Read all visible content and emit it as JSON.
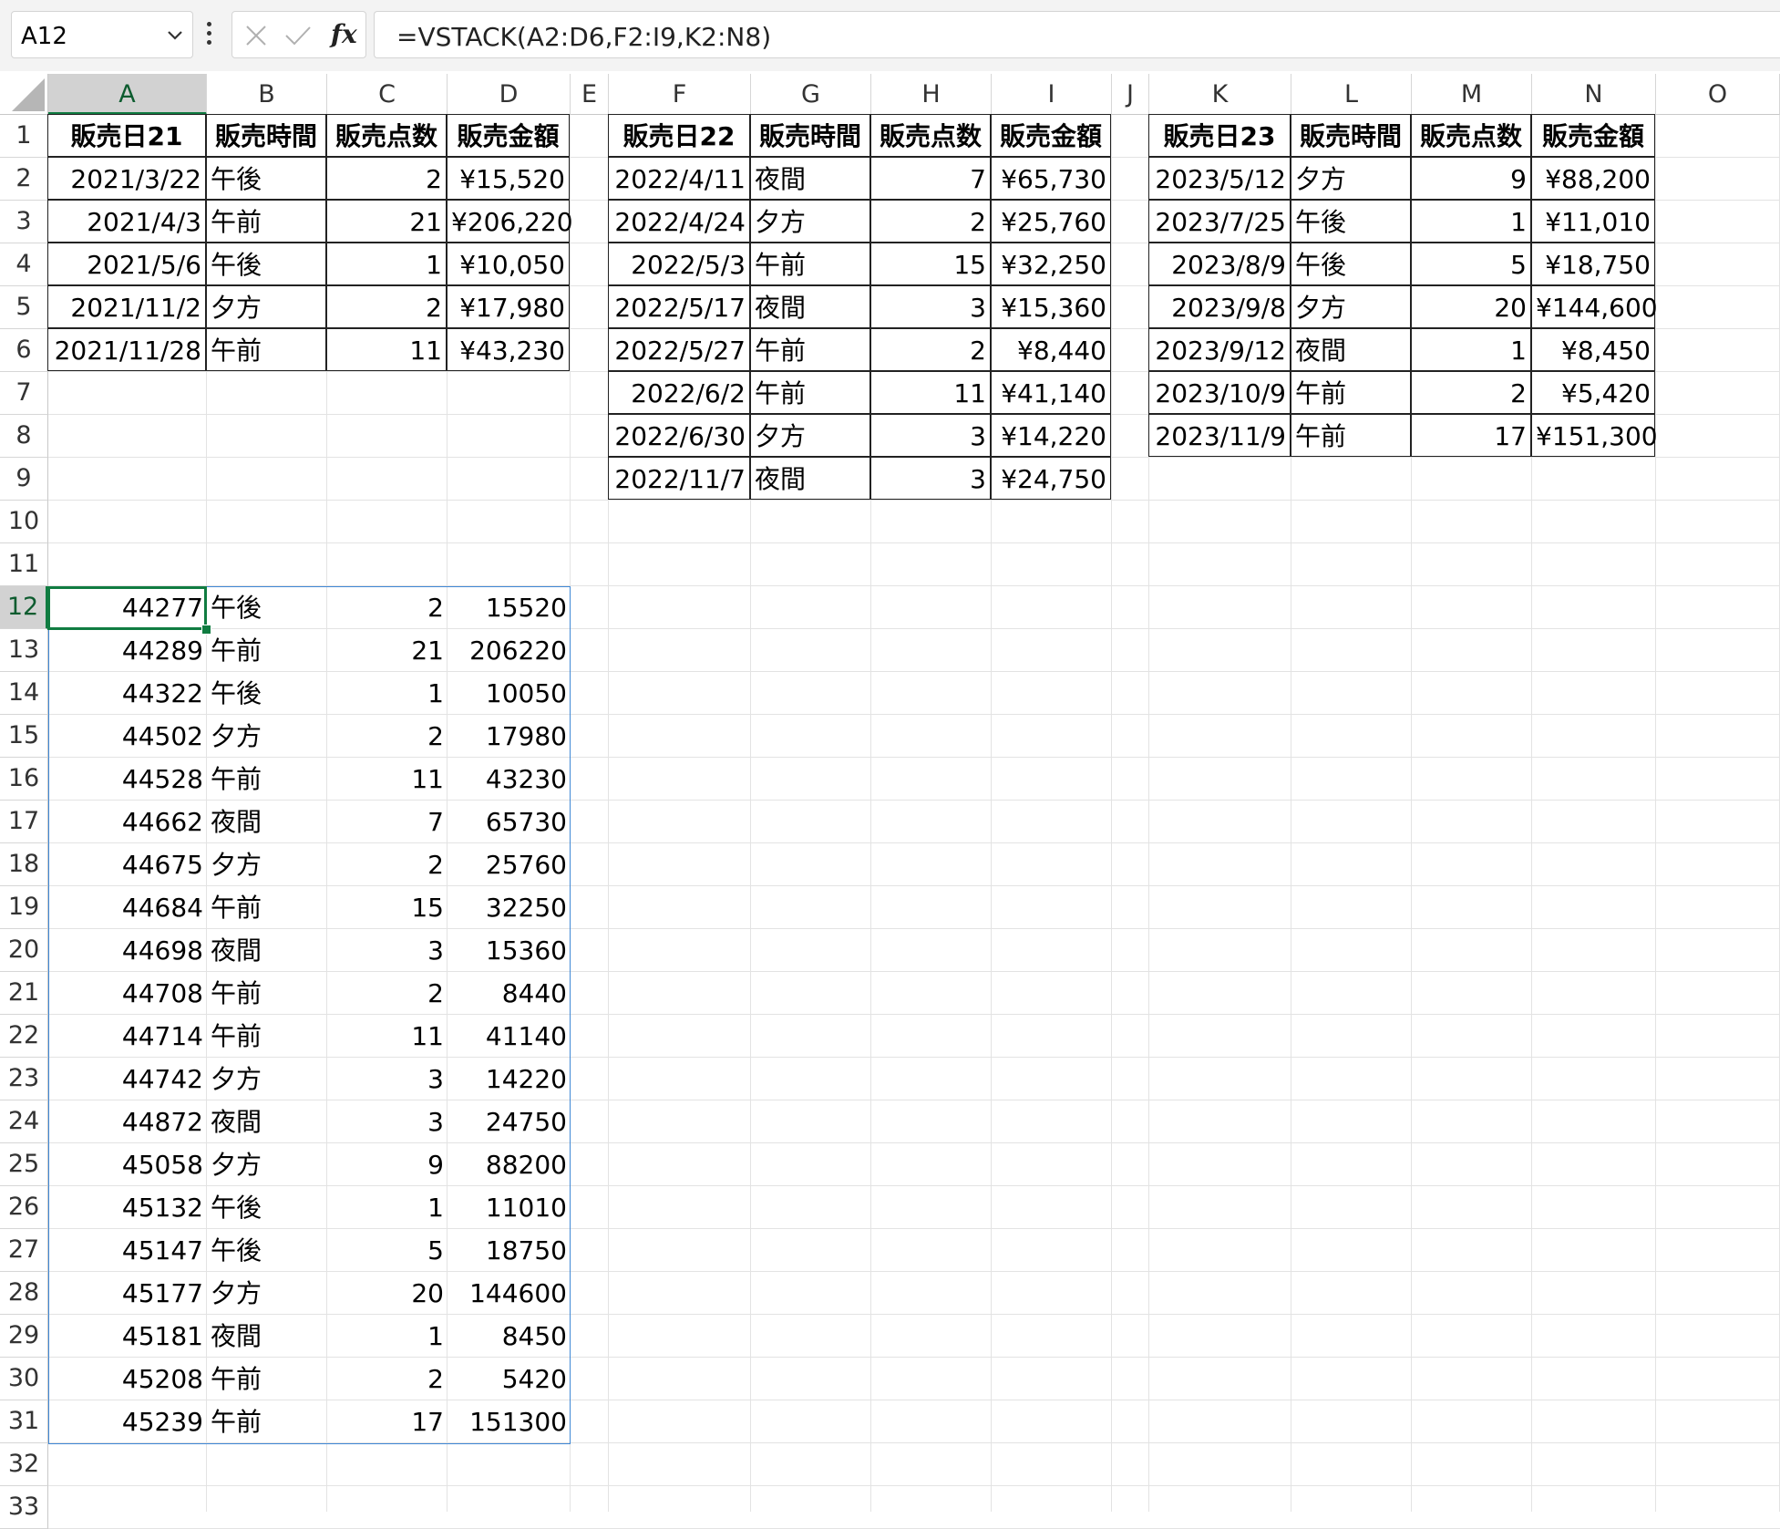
{
  "formula_bar": {
    "name_box": "A12",
    "formula": "=VSTACK(A2:D6,F2:I9,K2:N8)",
    "fx_label": "fx"
  },
  "columns": [
    "A",
    "B",
    "C",
    "D",
    "E",
    "F",
    "G",
    "H",
    "I",
    "J",
    "K",
    "L",
    "M",
    "N",
    "O"
  ],
  "rows": [
    "1",
    "2",
    "3",
    "4",
    "5",
    "6",
    "7",
    "8",
    "9",
    "10",
    "11",
    "12",
    "13",
    "14",
    "15",
    "16",
    "17",
    "18",
    "19",
    "20",
    "21",
    "22",
    "23",
    "24",
    "25",
    "26",
    "27",
    "28",
    "29",
    "30",
    "31",
    "32",
    "33"
  ],
  "active_cell": "A12",
  "table21": {
    "headers": [
      "販売日21",
      "販売時間",
      "販売点数",
      "販売金額"
    ],
    "rows": [
      [
        "2021/3/22",
        "午後",
        "2",
        "¥15,520"
      ],
      [
        "2021/4/3",
        "午前",
        "21",
        "¥206,220"
      ],
      [
        "2021/5/6",
        "午後",
        "1",
        "¥10,050"
      ],
      [
        "2021/11/2",
        "夕方",
        "2",
        "¥17,980"
      ],
      [
        "2021/11/28",
        "午前",
        "11",
        "¥43,230"
      ]
    ]
  },
  "table22": {
    "headers": [
      "販売日22",
      "販売時間",
      "販売点数",
      "販売金額"
    ],
    "rows": [
      [
        "2022/4/11",
        "夜間",
        "7",
        "¥65,730"
      ],
      [
        "2022/4/24",
        "夕方",
        "2",
        "¥25,760"
      ],
      [
        "2022/5/3",
        "午前",
        "15",
        "¥32,250"
      ],
      [
        "2022/5/17",
        "夜間",
        "3",
        "¥15,360"
      ],
      [
        "2022/5/27",
        "午前",
        "2",
        "¥8,440"
      ],
      [
        "2022/6/2",
        "午前",
        "11",
        "¥41,140"
      ],
      [
        "2022/6/30",
        "夕方",
        "3",
        "¥14,220"
      ],
      [
        "2022/11/7",
        "夜間",
        "3",
        "¥24,750"
      ]
    ]
  },
  "table23": {
    "headers": [
      "販売日23",
      "販売時間",
      "販売点数",
      "販売金額"
    ],
    "rows": [
      [
        "2023/5/12",
        "夕方",
        "9",
        "¥88,200"
      ],
      [
        "2023/7/25",
        "午後",
        "1",
        "¥11,010"
      ],
      [
        "2023/8/9",
        "午後",
        "5",
        "¥18,750"
      ],
      [
        "2023/9/8",
        "夕方",
        "20",
        "¥144,600"
      ],
      [
        "2023/9/12",
        "夜間",
        "1",
        "¥8,450"
      ],
      [
        "2023/10/9",
        "午前",
        "2",
        "¥5,420"
      ],
      [
        "2023/11/9",
        "午前",
        "17",
        "¥151,300"
      ]
    ]
  },
  "spill": {
    "rows": [
      [
        "44277",
        "午後",
        "2",
        "15520"
      ],
      [
        "44289",
        "午前",
        "21",
        "206220"
      ],
      [
        "44322",
        "午後",
        "1",
        "10050"
      ],
      [
        "44502",
        "夕方",
        "2",
        "17980"
      ],
      [
        "44528",
        "午前",
        "11",
        "43230"
      ],
      [
        "44662",
        "夜間",
        "7",
        "65730"
      ],
      [
        "44675",
        "夕方",
        "2",
        "25760"
      ],
      [
        "44684",
        "午前",
        "15",
        "32250"
      ],
      [
        "44698",
        "夜間",
        "3",
        "15360"
      ],
      [
        "44708",
        "午前",
        "2",
        "8440"
      ],
      [
        "44714",
        "午前",
        "11",
        "41140"
      ],
      [
        "44742",
        "夕方",
        "3",
        "14220"
      ],
      [
        "44872",
        "夜間",
        "3",
        "24750"
      ],
      [
        "45058",
        "夕方",
        "9",
        "88200"
      ],
      [
        "45132",
        "午後",
        "1",
        "11010"
      ],
      [
        "45147",
        "午後",
        "5",
        "18750"
      ],
      [
        "45177",
        "夕方",
        "20",
        "144600"
      ],
      [
        "45181",
        "夜間",
        "1",
        "8450"
      ],
      [
        "45208",
        "午前",
        "2",
        "5420"
      ],
      [
        "45239",
        "午前",
        "17",
        "151300"
      ]
    ]
  }
}
